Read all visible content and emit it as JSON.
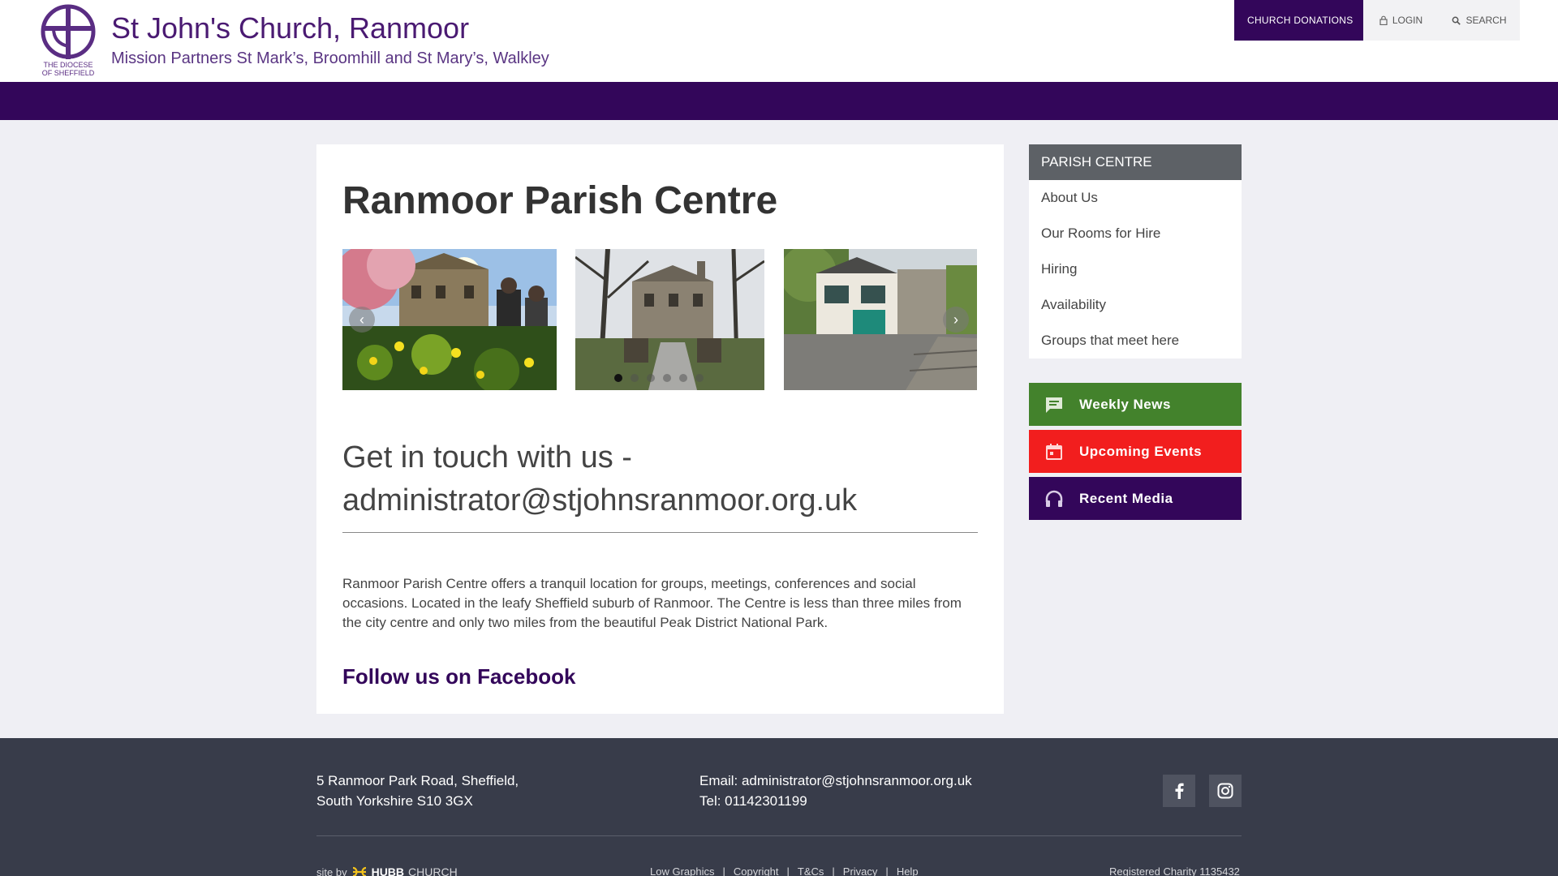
{
  "header": {
    "logo_line1": "THE DIOCESE",
    "logo_line2": "OF SHEFFIELD",
    "title": "St John's Church, Ranmoor",
    "subtitle": "Mission Partners St Mark’s, Broomhill and St Mary’s, Walkley",
    "donations_label": "CHURCH  DONATIONS",
    "login_label": "LOGIN",
    "search_label": "SEARCH",
    "brand_color": "#33065a"
  },
  "main": {
    "title": "Ranmoor Parish Centre",
    "carousel": {
      "slide_count": 6,
      "active_index": 0
    },
    "contact_heading_line1": "Get in touch with us -",
    "contact_heading_line2": "administrator@stjohnsranmoor.org.uk",
    "intro": "Ranmoor Parish Centre offers a tranquil location for groups, meetings, conferences and social occasions. Located in the leafy Sheffield suburb of Ranmoor. The Centre is less than three miles from the city centre and only two miles from the beautiful Peak District National Park.",
    "facebook_link": "Follow us on Facebook"
  },
  "sidebar": {
    "menu_title": "PARISH CENTRE",
    "items": [
      {
        "label": "About Us"
      },
      {
        "label": "Our Rooms for Hire"
      },
      {
        "label": "Hiring"
      },
      {
        "label": "Availability"
      },
      {
        "label": "Groups that meet here"
      }
    ],
    "quick_links": [
      {
        "label": "Weekly  News",
        "icon": "chat-icon",
        "color": "#43822c"
      },
      {
        "label": "Upcoming  Events",
        "icon": "calendar-icon",
        "color": "#f21e1e"
      },
      {
        "label": "Recent  Media",
        "icon": "headphones-icon",
        "color": "#33065a"
      }
    ]
  },
  "footer": {
    "address_line1": "5 Ranmoor Park Road, Sheffield,",
    "address_line2": "South Yorkshire S10 3GX",
    "email_label": "Email:  administrator@stjohnsranmoor.org.uk",
    "tel_label": "Tel:  01142301199",
    "site_by": "site by",
    "hubb": "HUBB",
    "hubb_church": "CHURCH",
    "links": [
      "Low Graphics",
      "Copyright",
      "T&Cs",
      "Privacy",
      "Help"
    ],
    "charity": "Registered Charity 1135432",
    "background_color": "#383c4a"
  }
}
